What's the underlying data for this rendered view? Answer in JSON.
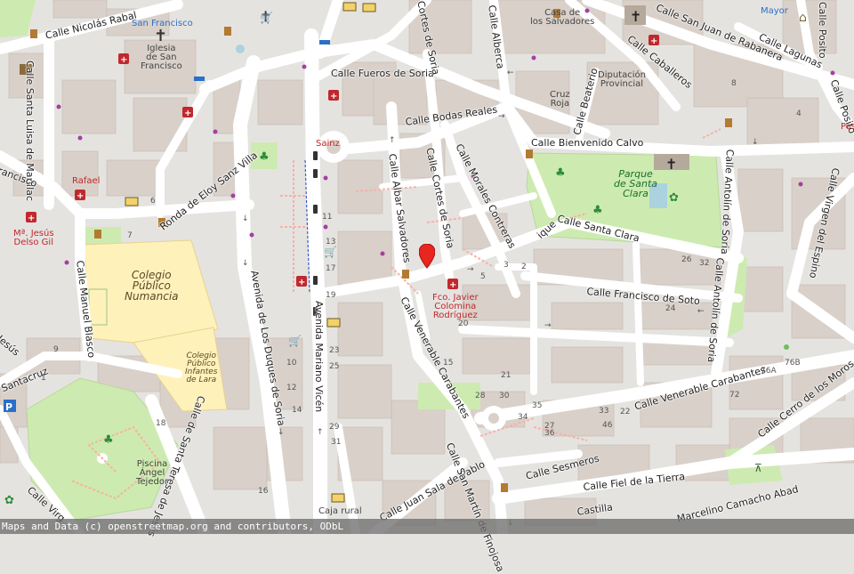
{
  "streets": [
    {
      "id": "nicolas-rabal",
      "text": "Calle Nicolás Rabal"
    },
    {
      "id": "santa-luisa",
      "text": "Calle Santa Luisa de Marillac"
    },
    {
      "id": "eloy-sanz",
      "text": "Ronda de Eloy Sanz Villa"
    },
    {
      "id": "fueros",
      "text": "Calle Fueros de Soria"
    },
    {
      "id": "bodas",
      "text": "Calle Bodas Reales"
    },
    {
      "id": "cortes-top",
      "text": "Cortes de Soria"
    },
    {
      "id": "alberca",
      "text": "Calle Alberca"
    },
    {
      "id": "san-juan",
      "text": "Calle San Juan de Rabanera"
    },
    {
      "id": "caballeros",
      "text": "Calle Caballeros"
    },
    {
      "id": "lagunas",
      "text": "Calle Lagunas"
    },
    {
      "id": "posito",
      "text": "Calle Posito"
    },
    {
      "id": "posito-top",
      "text": "Calle Posito"
    },
    {
      "id": "beaterio",
      "text": "Calle Beaterio"
    },
    {
      "id": "bienvenido",
      "text": "Calle Bienvenido Calvo"
    },
    {
      "id": "albar",
      "text": "Calle Albar Salvadores"
    },
    {
      "id": "cortes-mid",
      "text": "Calle Cortes de Soria"
    },
    {
      "id": "morales",
      "text": "Calle Morales Contreras"
    },
    {
      "id": "santa-clara",
      "text": "Calle Santa Clara"
    },
    {
      "id": "antolin-1",
      "text": "Calle Antolín de Soria"
    },
    {
      "id": "antolin-2",
      "text": "Calle Antolín de Soria"
    },
    {
      "id": "virgen",
      "text": "Calle Virgen del Espino"
    },
    {
      "id": "francisco-soto",
      "text": "Calle Francisco de Soto"
    },
    {
      "id": "duques",
      "text": "Avenida de Los Duques de Soria"
    },
    {
      "id": "mariano",
      "text": "Avenida Mariano Vicén"
    },
    {
      "id": "manuel-blasco",
      "text": "Calle Manuel Blasco"
    },
    {
      "id": "venerable-1",
      "text": "Calle Venerable Carabantes"
    },
    {
      "id": "venerable-2",
      "text": "Calle Venerable Carabantes"
    },
    {
      "id": "cerro",
      "text": "Calle Cerro de los Moros"
    },
    {
      "id": "santa-teresa",
      "text": "Calle de Santa Teresa de Jesús"
    },
    {
      "id": "juan-sala",
      "text": "Calle Juan Sala de Pablo"
    },
    {
      "id": "san-martin",
      "text": "Calle San Martín de Finojosa"
    },
    {
      "id": "sesmeros",
      "text": "Calle Sesmeros"
    },
    {
      "id": "fiel",
      "text": "Calle Fiel de la Tierra"
    },
    {
      "id": "camacho",
      "text": "Marcelino Camacho Abad"
    },
    {
      "id": "castilla",
      "text": "Castilla"
    },
    {
      "id": "francisco-left",
      "text": "rancisco"
    },
    {
      "id": "jesus-left",
      "text": "Jesús"
    },
    {
      "id": "santacruz",
      "text": "Santacruz"
    },
    {
      "id": "virg-left",
      "text": "Calle Virg"
    },
    {
      "id": "enrique",
      "text": "ique"
    }
  ],
  "places": [
    {
      "id": "san-francisco",
      "text": "San Francisco",
      "style": "blue-lbl"
    },
    {
      "id": "iglesia",
      "text": "Iglesia\nde San\nFrancisco",
      "style": "place"
    },
    {
      "id": "casa-salvadores",
      "text": "Casa de\nlos Salvadores",
      "style": "place"
    },
    {
      "id": "diputacion",
      "text": "Diputación\nProvincial",
      "style": "place"
    },
    {
      "id": "cruz-roja",
      "text": "Cruz\nRoja",
      "style": "place"
    },
    {
      "id": "mayor",
      "text": "Mayor",
      "style": "blue-lbl"
    },
    {
      "id": "pos",
      "text": "Pos",
      "style": "red-lbl"
    },
    {
      "id": "rafael",
      "text": "Rafael",
      "style": "red-lbl"
    },
    {
      "id": "sainz",
      "text": "Sainz",
      "style": "red-lbl"
    },
    {
      "id": "mjesus",
      "text": "Mª. Jesús\nDelso Gil",
      "style": "red-lbl"
    },
    {
      "id": "colomina",
      "text": "Fco. Javier\nColomina\nRodríguez",
      "style": "red-lbl"
    },
    {
      "id": "parque",
      "text": "Parque\nde Santa\nClara",
      "style": "green-lbl"
    },
    {
      "id": "colegio-numancia",
      "text": "Colegio\nPúblico\nNumancia",
      "style": "school-lbl"
    },
    {
      "id": "colegio-infantes",
      "text": "Colegio\nPúblico\nInfantes\nde Lara",
      "style": "school-sm"
    },
    {
      "id": "piscina",
      "text": "Piscina\nÁngel\nTejedor",
      "style": "place"
    },
    {
      "id": "caja-rural",
      "text": "Caja rural",
      "style": "place"
    }
  ],
  "house_numbers": [
    {
      "id": "n6",
      "text": "6"
    },
    {
      "id": "n7",
      "text": "7"
    },
    {
      "id": "n9",
      "text": "9"
    },
    {
      "id": "n11",
      "text": "11"
    },
    {
      "id": "n13",
      "text": "13"
    },
    {
      "id": "n17",
      "text": "17"
    },
    {
      "id": "n19",
      "text": "19"
    },
    {
      "id": "n23",
      "text": "23"
    },
    {
      "id": "n25",
      "text": "25"
    },
    {
      "id": "n29",
      "text": "29"
    },
    {
      "id": "n31",
      "text": "31"
    },
    {
      "id": "n10",
      "text": "10"
    },
    {
      "id": "n12",
      "text": "12"
    },
    {
      "id": "n14",
      "text": "14"
    },
    {
      "id": "n16",
      "text": "16"
    },
    {
      "id": "n18",
      "text": "18"
    },
    {
      "id": "n20",
      "text": "20"
    },
    {
      "id": "n21",
      "text": "21"
    },
    {
      "id": "n26",
      "text": "26"
    },
    {
      "id": "n32",
      "text": "32"
    },
    {
      "id": "n28",
      "text": "28"
    },
    {
      "id": "n30",
      "text": "30"
    },
    {
      "id": "n33",
      "text": "33"
    },
    {
      "id": "n34",
      "text": "34"
    },
    {
      "id": "n35",
      "text": "35"
    },
    {
      "id": "n27",
      "text": "27"
    },
    {
      "id": "n46",
      "text": "46"
    },
    {
      "id": "n72",
      "text": "72"
    },
    {
      "id": "n76a",
      "text": "76A"
    },
    {
      "id": "n76b",
      "text": "76B"
    },
    {
      "id": "n1",
      "text": "1"
    },
    {
      "id": "n3",
      "text": "3"
    },
    {
      "id": "n2",
      "text": "2"
    },
    {
      "id": "n4",
      "text": "4"
    },
    {
      "id": "n5",
      "text": "5"
    },
    {
      "id": "n8",
      "text": "8"
    },
    {
      "id": "n15",
      "text": "15"
    },
    {
      "id": "n22",
      "text": "22"
    },
    {
      "id": "n24",
      "text": "24"
    },
    {
      "id": "n36",
      "text": "36"
    }
  ],
  "attribution": "Maps and Data (c) openstreetmap.org and contributors, ODbL",
  "colors": {
    "background": "#e5e3e0",
    "building": "#d9d0c9",
    "road": "#ffffff",
    "park": "#cdebb0",
    "school": "#fff1ba",
    "pharmacy": "#c0282c",
    "marker": "#e8251f"
  }
}
